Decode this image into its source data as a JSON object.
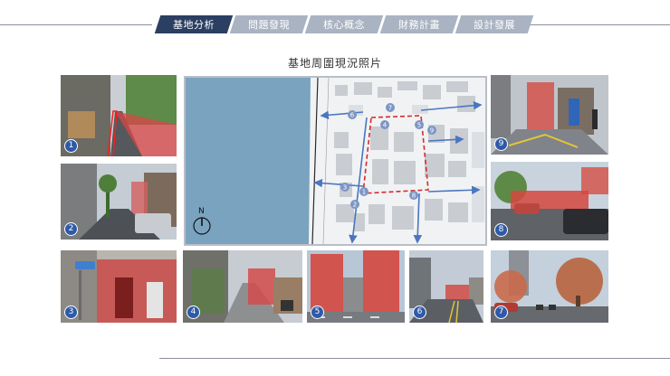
{
  "tabs": [
    {
      "label": "基地分析",
      "active": true
    },
    {
      "label": "問題發現",
      "active": false
    },
    {
      "label": "核心概念",
      "active": false
    },
    {
      "label": "財務計畫",
      "active": false
    },
    {
      "label": "設計發展",
      "active": false
    }
  ],
  "page_title": "基地周圍現況照片",
  "map": {
    "north_label": "N",
    "markers": [
      "1",
      "2",
      "3",
      "4",
      "5",
      "6",
      "7",
      "8",
      "9"
    ]
  },
  "photos": [
    {
      "number": "1"
    },
    {
      "number": "2"
    },
    {
      "number": "3"
    },
    {
      "number": "4"
    },
    {
      "number": "5"
    },
    {
      "number": "6"
    },
    {
      "number": "7"
    },
    {
      "number": "8"
    },
    {
      "number": "9"
    }
  ],
  "colors": {
    "active_tab": "#2b3f62",
    "inactive_tab": "#aab3c2",
    "arrow": "#4a76c0",
    "site_outline": "#d62a2a",
    "river": "#7aa3c0"
  }
}
